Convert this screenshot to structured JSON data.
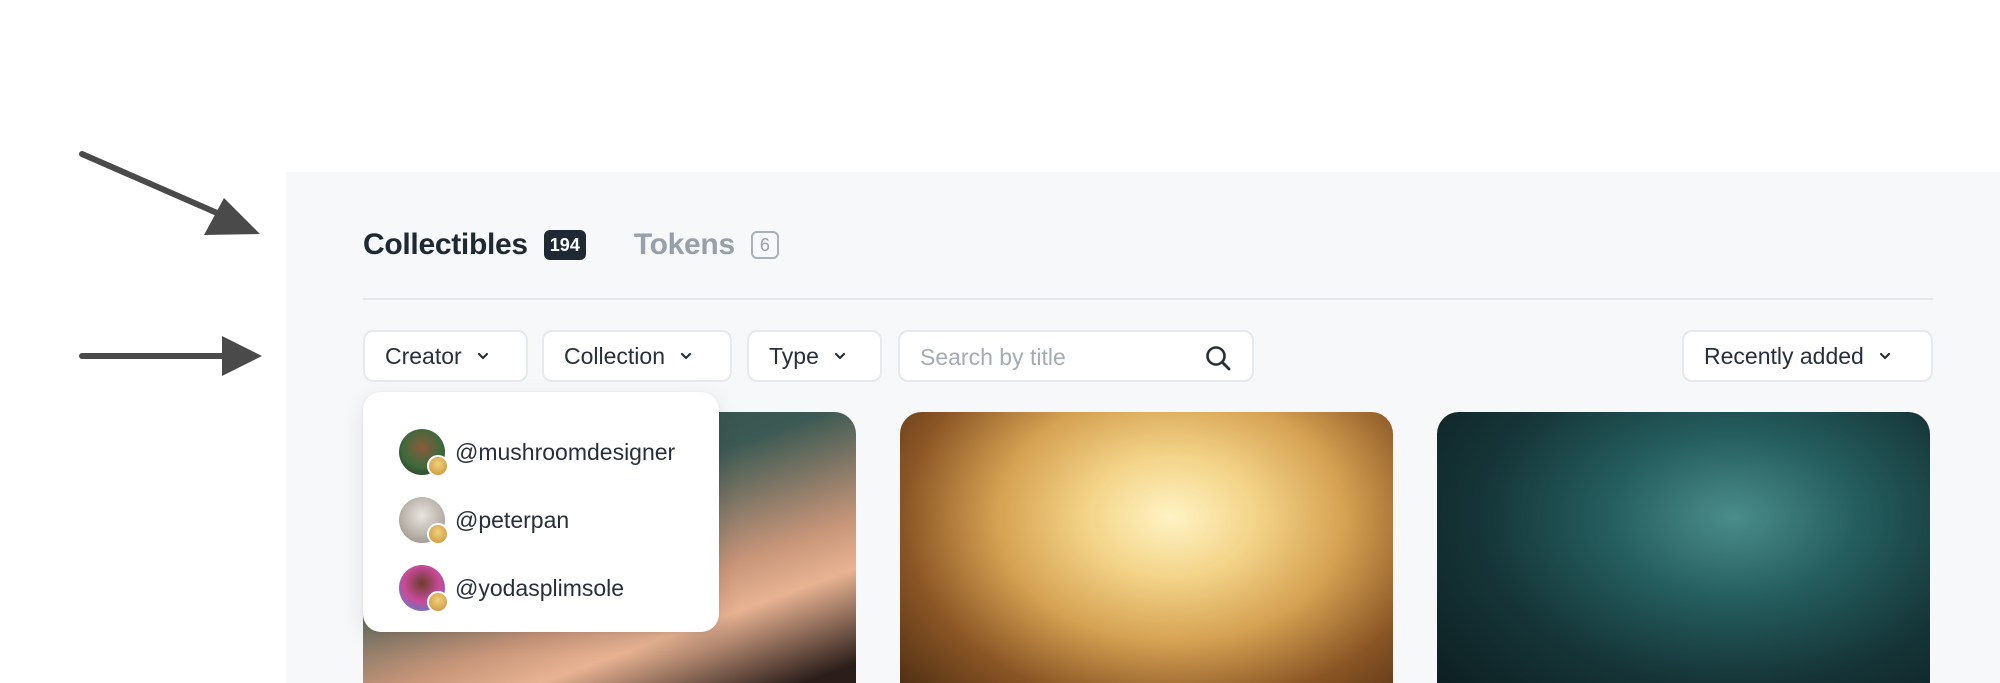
{
  "tabs": [
    {
      "label": "Collectibles",
      "count": "194"
    },
    {
      "label": "Tokens",
      "count": "6"
    }
  ],
  "filters": {
    "creator_label": "Creator",
    "collection_label": "Collection",
    "type_label": "Type",
    "search_placeholder": "Search by title",
    "search_value": "",
    "sort_label": "Recently added"
  },
  "creator_dropdown": {
    "items": [
      {
        "handle": "@mushroomdesigner"
      },
      {
        "handle": "@peterpan"
      },
      {
        "handle": "@yodasplimsole"
      }
    ]
  },
  "colors": {
    "accent_dark": "#1f2933",
    "muted": "#96a0ab",
    "panel_bg": "#f7f8fa",
    "arrow": "#4a4a4a"
  },
  "icons": [
    "arrow-icon",
    "chevron-down-icon",
    "search-icon"
  ]
}
